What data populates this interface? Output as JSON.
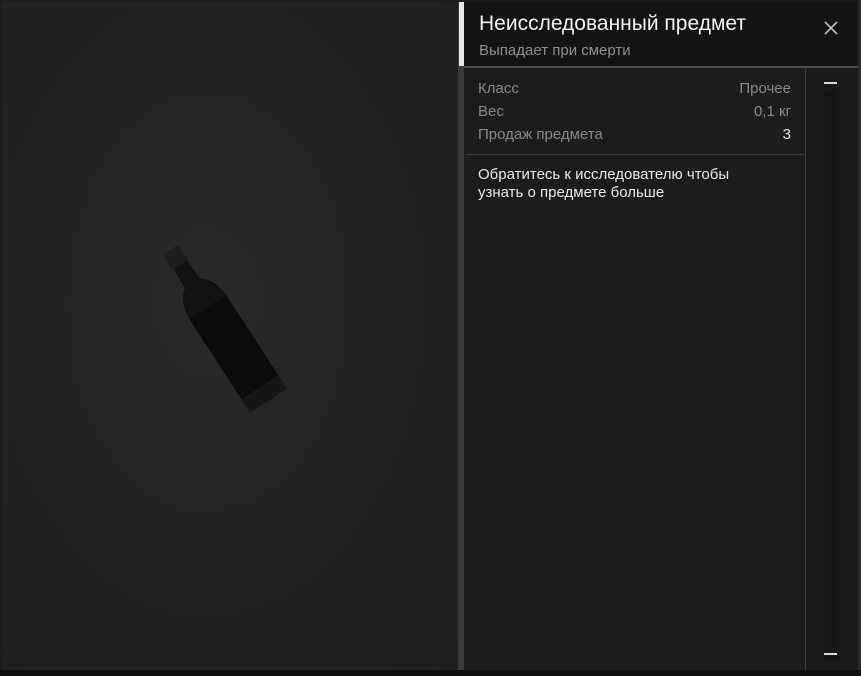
{
  "header": {
    "title": "Неисследованный предмет",
    "subtitle": "Выпадает при смерти"
  },
  "properties": [
    {
      "label": "Класс",
      "value": "Прочее"
    },
    {
      "label": "Вес",
      "value": "0,1 кг"
    },
    {
      "label": "Продаж предмета",
      "value": "3"
    }
  ],
  "description": "Обратитесь к исследователю чтобы узнать о предмете больше",
  "icons": {
    "close": "close-icon",
    "item": "bottle-icon"
  },
  "colors": {
    "background": "#1b1b1b",
    "header_bg": "#141414",
    "accent": "#e8e8e8",
    "muted_text": "#8a8a8a"
  }
}
